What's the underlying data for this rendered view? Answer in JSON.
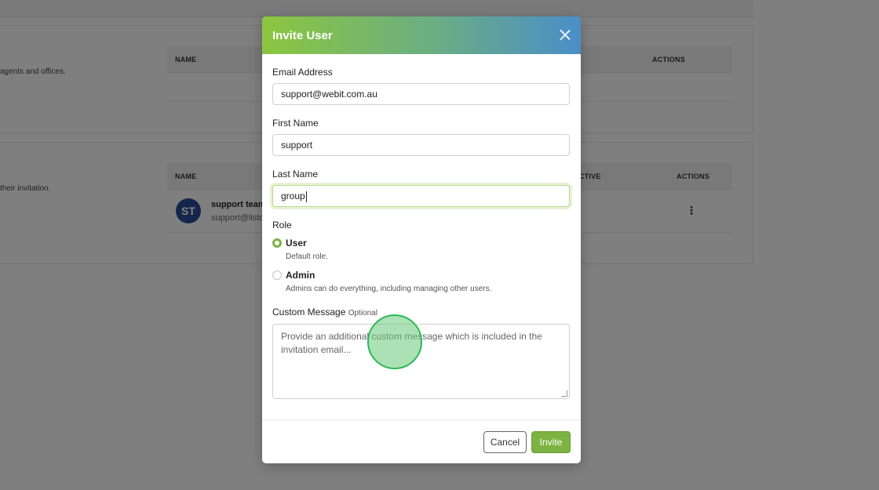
{
  "background": {
    "card1": {
      "description": "agents and offices.",
      "columns": {
        "name": "NAME",
        "actions": "ACTIONS"
      }
    },
    "card2": {
      "description": "their invitation.",
      "columns": {
        "name": "NAME",
        "active": "CTIVE",
        "actions": "ACTIONS"
      },
      "member": {
        "initials": "ST",
        "name": "support team",
        "email": "support@listo"
      },
      "row_menu_icon": "kebab-icon"
    }
  },
  "modal": {
    "title": "Invite User",
    "close_icon": "close-icon",
    "email": {
      "label": "Email Address",
      "value": "support@webit.com.au"
    },
    "first_name": {
      "label": "First Name",
      "value": "support"
    },
    "last_name": {
      "label": "Last Name",
      "value": "group"
    },
    "role": {
      "label": "Role",
      "options": [
        {
          "title": "User",
          "description": "Default role.",
          "selected": true
        },
        {
          "title": "Admin",
          "description": "Admins can do everything, including managing other users.",
          "selected": false
        }
      ]
    },
    "custom_message": {
      "label": "Custom Message",
      "optional_tag": "Optional",
      "placeholder": "Provide an additional custom message which is included in the invitation email..."
    },
    "buttons": {
      "cancel": "Cancel",
      "invite": "Invite"
    }
  },
  "colors": {
    "accent_green": "#7cb342",
    "header_gradient_start": "#8cc63f",
    "header_gradient_end": "#4a8ec9",
    "avatar_blue": "#2b4d98"
  }
}
